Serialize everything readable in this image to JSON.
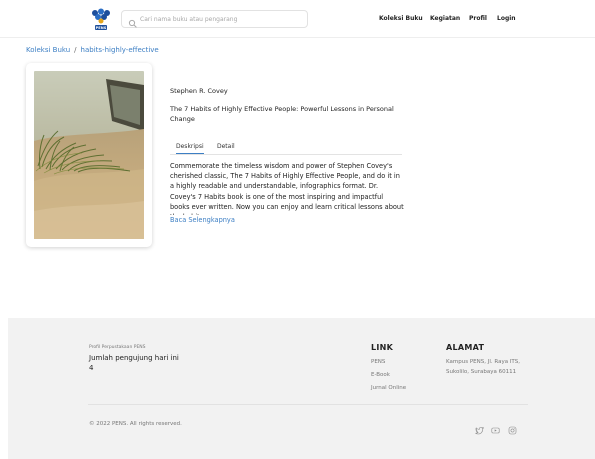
{
  "header": {
    "search_placeholder": "Cari nama buku atau pengarang",
    "nav": [
      "Koleksi Buku",
      "Kegiatan",
      "Profil",
      "Login"
    ],
    "logo_text": "PENS"
  },
  "breadcrumb": {
    "root": "Koleksi Buku",
    "separator": "/",
    "current": "habits-highly-effective"
  },
  "book": {
    "author": "Stephen R. Covey",
    "title": "The 7 Habits of Highly Effective People: Powerful Lessons in Personal Change",
    "tabs": [
      "Deskripsi",
      "Detail"
    ],
    "active_tab": "Deskripsi",
    "description": "Commemorate the timeless wisdom and power of Stephen Covey's cherished classic, The 7 Habits of Highly Effective People, and do it in a highly readable and understandable, infographics format. Dr. Covey's 7 Habits book is one of the most inspiring and impactful books ever written. Now you can enjoy and learn critical lessons about the habits",
    "read_more": "Baca Selengkapnya"
  },
  "footer": {
    "library_label": "Profil Perpustakaan PENS",
    "visitors_label": "Jumlah pengujung hari ini",
    "visitors_count": "4",
    "link_heading": "LINK",
    "links": [
      "PENS",
      "E-Book",
      "Jurnal Online"
    ],
    "address_heading": "ALAMAT",
    "address": "Kampus PENS, Jl. Raya ITS, Sukolilo, Surabaya 60111",
    "copyright": "© 2022 PENS. All rights reserved."
  },
  "colors": {
    "accent": "#3d7fc4",
    "footer_bg": "#f2f2f2"
  }
}
